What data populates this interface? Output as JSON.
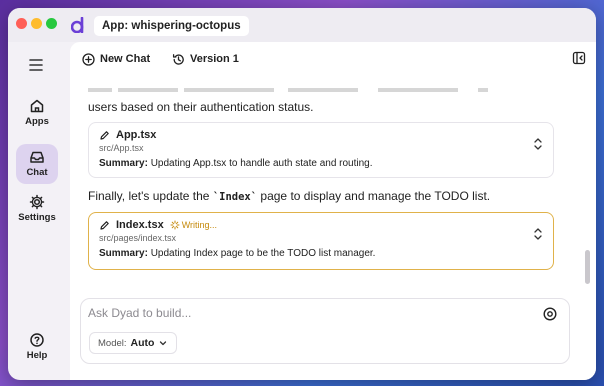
{
  "window": {
    "app_title": "App: whispering-octopus"
  },
  "sidebar": {
    "items": [
      {
        "label": "Apps"
      },
      {
        "label": "Chat"
      },
      {
        "label": "Settings"
      },
      {
        "label": "Help"
      }
    ]
  },
  "toolbar": {
    "new_chat_label": "New Chat",
    "version_label": "Version 1"
  },
  "chat": {
    "partial_text": "users based on their authentication status.",
    "cards": [
      {
        "filename": "App.tsx",
        "path": "src/App.tsx",
        "summary_label": "Summary:",
        "summary_text": "Updating App.tsx to handle auth state and routing."
      },
      {
        "filename": "Index.tsx",
        "status": "Writing...",
        "path": "src/pages/index.tsx",
        "summary_label": "Summary:",
        "summary_text": "Updating Index page to be the TODO list manager."
      }
    ],
    "message2_before": "Finally, let's update the ",
    "message2_code": "`Index`",
    "message2_after": " page to display and manage the TODO list."
  },
  "composer": {
    "placeholder": "Ask Dyad to build...",
    "model_label": "Model:",
    "model_value": "Auto"
  },
  "colors": {
    "accent": "#6b3fd6",
    "active_nav": "#ddd3ef",
    "writing": "#c58a0c"
  }
}
